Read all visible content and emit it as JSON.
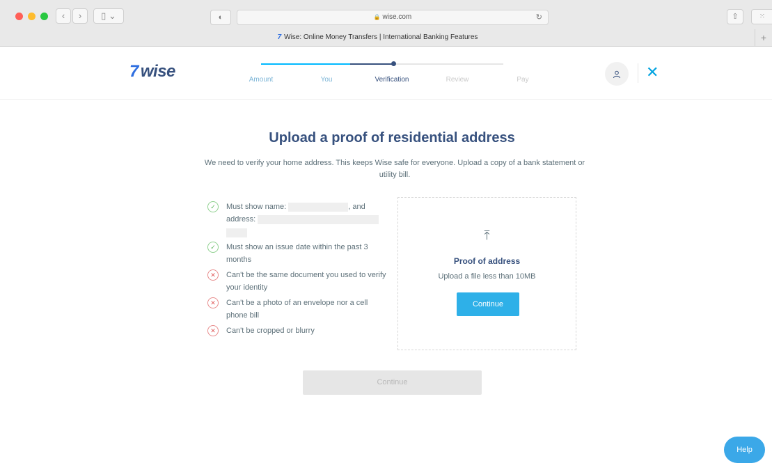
{
  "browser": {
    "url": "wise.com",
    "tab_title": "Wise: Online Money Transfers | International Banking Features",
    "tab_favicon": "7",
    "back_glyph": "‹",
    "forward_glyph": "›",
    "sidebar_glyph": "▯",
    "chevron_glyph": "⌄",
    "shield_glyph": "◐",
    "lock_glyph": "🔒",
    "reload_glyph": "↻",
    "share_glyph": "⇧",
    "tabs_glyph": "⁙",
    "new_tab_glyph": "+"
  },
  "header": {
    "logo_flag": "7",
    "logo_text": "wise",
    "steps": [
      {
        "label": "Amount",
        "state": "done"
      },
      {
        "label": "You",
        "state": "done"
      },
      {
        "label": "Verification",
        "state": "current"
      },
      {
        "label": "Review",
        "state": "upcoming"
      },
      {
        "label": "Pay",
        "state": "upcoming"
      }
    ],
    "profile_icon": "person-icon",
    "close_glyph": "✕"
  },
  "main": {
    "title": "Upload a proof of residential address",
    "subtitle": "We need to verify your home address. This keeps Wise safe for everyone. Upload a copy of a bank statement or utility bill.",
    "requirements": [
      {
        "type": "ok",
        "text_a": "Must show name:",
        "text_b": ", and address:"
      },
      {
        "type": "ok",
        "text": "Must show an issue date within the past 3 months"
      },
      {
        "type": "no",
        "text": "Can't be the same document you used to verify your identity"
      },
      {
        "type": "no",
        "text": "Can't be a photo of an envelope nor a cell phone bill"
      },
      {
        "type": "no",
        "text": "Can't be cropped or blurry"
      }
    ],
    "ok_glyph": "✓",
    "no_glyph": "✕",
    "upload": {
      "icon": "upload-icon",
      "icon_glyph": "⤒",
      "title": "Proof of address",
      "hint": "Upload a file less than 10MB",
      "button_label": "Continue"
    },
    "continue_label": "Continue",
    "help_label": "Help"
  },
  "colors": {
    "navy": "#37517e",
    "accent_blue": "#00b9ff",
    "button_blue": "#2eb0e8",
    "ok_green": "#5cb85c",
    "error_red": "#e05a5a"
  }
}
